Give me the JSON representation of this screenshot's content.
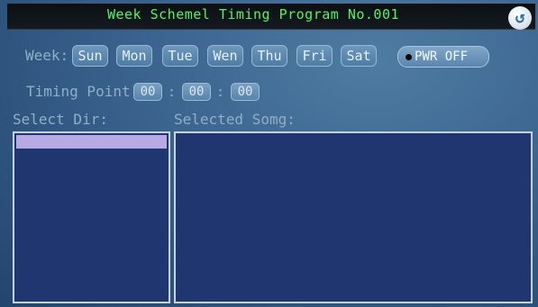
{
  "title": "Week Schemel Timing Program No.001",
  "week": {
    "label": "Week:",
    "days": [
      "Sun",
      "Mon",
      "Tue",
      "Wen",
      "Thu",
      "Fri",
      "Sat"
    ]
  },
  "power": {
    "label": "PWR OFF"
  },
  "timing": {
    "label": "Timing Point",
    "hour": "00",
    "minute": "00",
    "second": "00",
    "separator": ":"
  },
  "select_dir": {
    "label": "Select Dir:"
  },
  "selected_song": {
    "label": "Selected Somg:"
  },
  "colors": {
    "title_text": "#58f06a",
    "panel_bg": "#1f3670",
    "list_highlight": "#b7a9e4"
  }
}
